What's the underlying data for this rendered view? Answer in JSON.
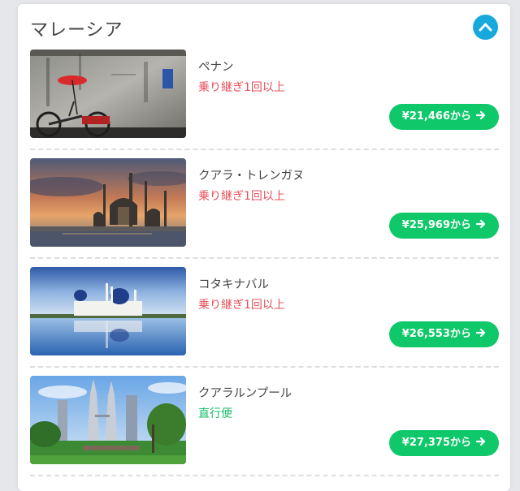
{
  "section": {
    "title": "マレーシア",
    "collapse_icon": "chevron-up-icon",
    "accent_color": "#17a9dc"
  },
  "destinations": [
    {
      "city": "ペナン",
      "transit": "乗り継ぎ1回以上",
      "transit_type": "connection",
      "price": "¥21,466から"
    },
    {
      "city": "クアラ・トレンガヌ",
      "transit": "乗り継ぎ1回以上",
      "transit_type": "connection",
      "price": "¥25,969から"
    },
    {
      "city": "コタキナバル",
      "transit": "乗り継ぎ1回以上",
      "transit_type": "connection",
      "price": "¥26,553から"
    },
    {
      "city": "クアラルンプール",
      "transit": "直行便",
      "transit_type": "direct",
      "price": "¥27,375から"
    }
  ],
  "colors": {
    "price_button": "#0ec86a",
    "connection_text": "#e8505b",
    "direct_text": "#1bbf6a"
  },
  "price_arrow_icon": "arrow-right-icon"
}
